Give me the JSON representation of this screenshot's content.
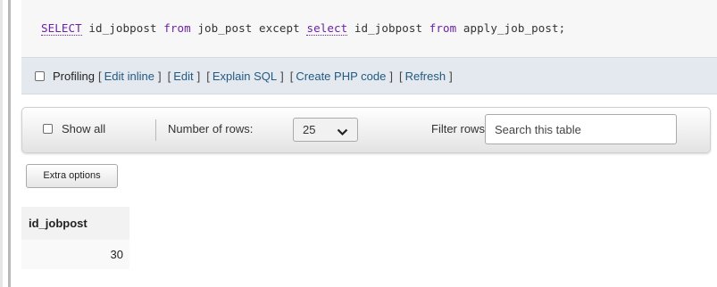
{
  "sql": {
    "kw_select": "SELECT",
    "t1": " id_jobpost ",
    "kw_from": "from",
    "t2": " job_post except ",
    "kw_select2": "select",
    "t3": " id_jobpost ",
    "kw_from2": "from",
    "t4": " apply_job_post;"
  },
  "profiling": {
    "label": "Profiling",
    "links": [
      "Edit inline",
      "Edit",
      "Explain SQL",
      "Create PHP code",
      "Refresh"
    ]
  },
  "navigation": {
    "show_all": "Show all",
    "rows_label": "Number of rows:",
    "rows_value": "25",
    "filter_label": "Filter rows:",
    "search_placeholder": "Search this table"
  },
  "extra_options": "Extra options",
  "results": {
    "columns": [
      "id_jobpost"
    ],
    "rows": [
      [
        "30"
      ]
    ]
  },
  "colors": {
    "keyword": "#6a22a6",
    "link": "#235a81",
    "profiling_bg": "#e3e9ef"
  },
  "icons": {
    "profiling_checkbox": "checkbox-icon",
    "show_all_checkbox": "checkbox-icon",
    "rows_dropdown": "chevron-down-icon"
  }
}
